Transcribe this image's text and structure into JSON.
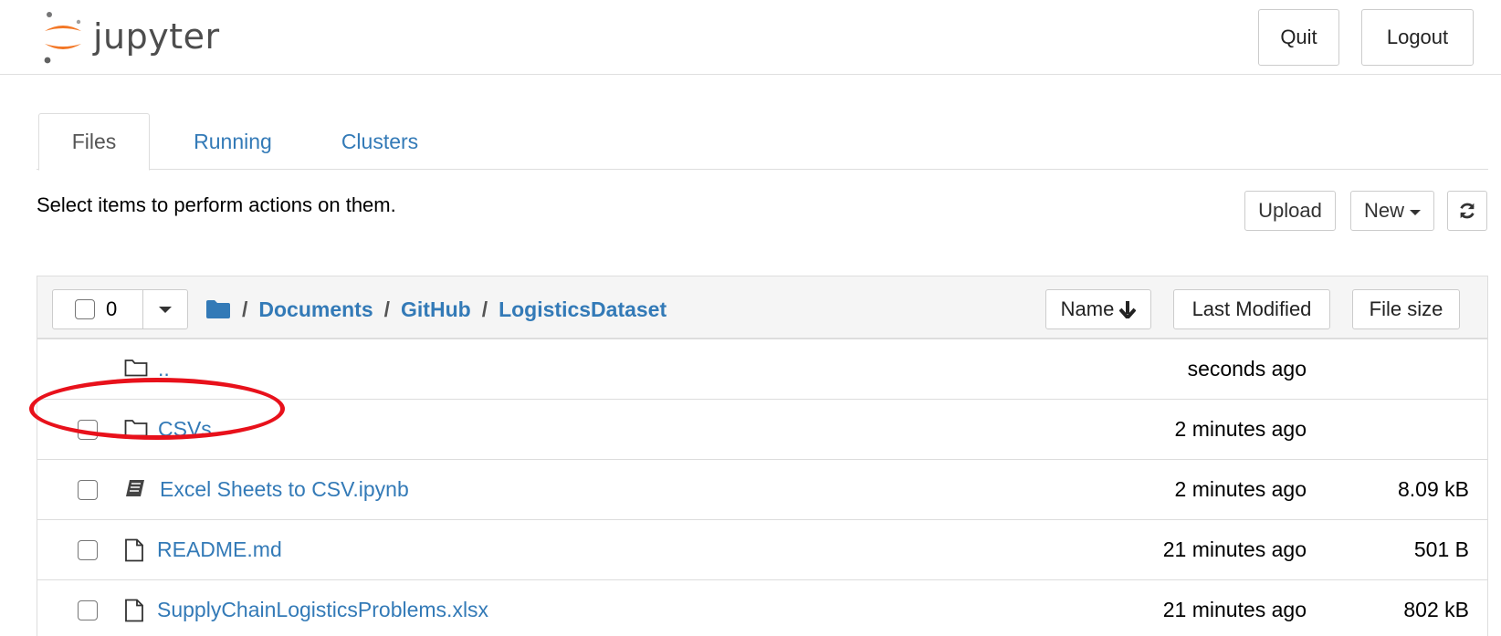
{
  "header": {
    "logo_text": "jupyter",
    "quit_label": "Quit",
    "logout_label": "Logout"
  },
  "tabs": [
    {
      "label": "Files",
      "active": true
    },
    {
      "label": "Running",
      "active": false
    },
    {
      "label": "Clusters",
      "active": false
    }
  ],
  "toolbar": {
    "hint": "Select items to perform actions on them.",
    "upload_label": "Upload",
    "new_label": "New"
  },
  "list": {
    "selected_count": "0",
    "breadcrumb": [
      "Documents",
      "GitHub",
      "LogisticsDataset"
    ],
    "breadcrumb_sep": "/",
    "sort_name_label": "Name",
    "sort_modified_label": "Last Modified",
    "sort_size_label": "File size",
    "rows": [
      {
        "name": "..",
        "type": "parent-folder",
        "modified": "seconds ago",
        "size": ""
      },
      {
        "name": "CSVs",
        "type": "folder",
        "modified": "2 minutes ago",
        "size": ""
      },
      {
        "name": "Excel Sheets to CSV.ipynb",
        "type": "notebook",
        "modified": "2 minutes ago",
        "size": "8.09 kB"
      },
      {
        "name": "README.md",
        "type": "file",
        "modified": "21 minutes ago",
        "size": "501 B"
      },
      {
        "name": "SupplyChainLogisticsProblems.xlsx",
        "type": "file",
        "modified": "21 minutes ago",
        "size": "802 kB"
      }
    ]
  },
  "colors": {
    "link": "#337ab7",
    "highlight": "#e8111b",
    "logo_orange": "#f37726"
  }
}
